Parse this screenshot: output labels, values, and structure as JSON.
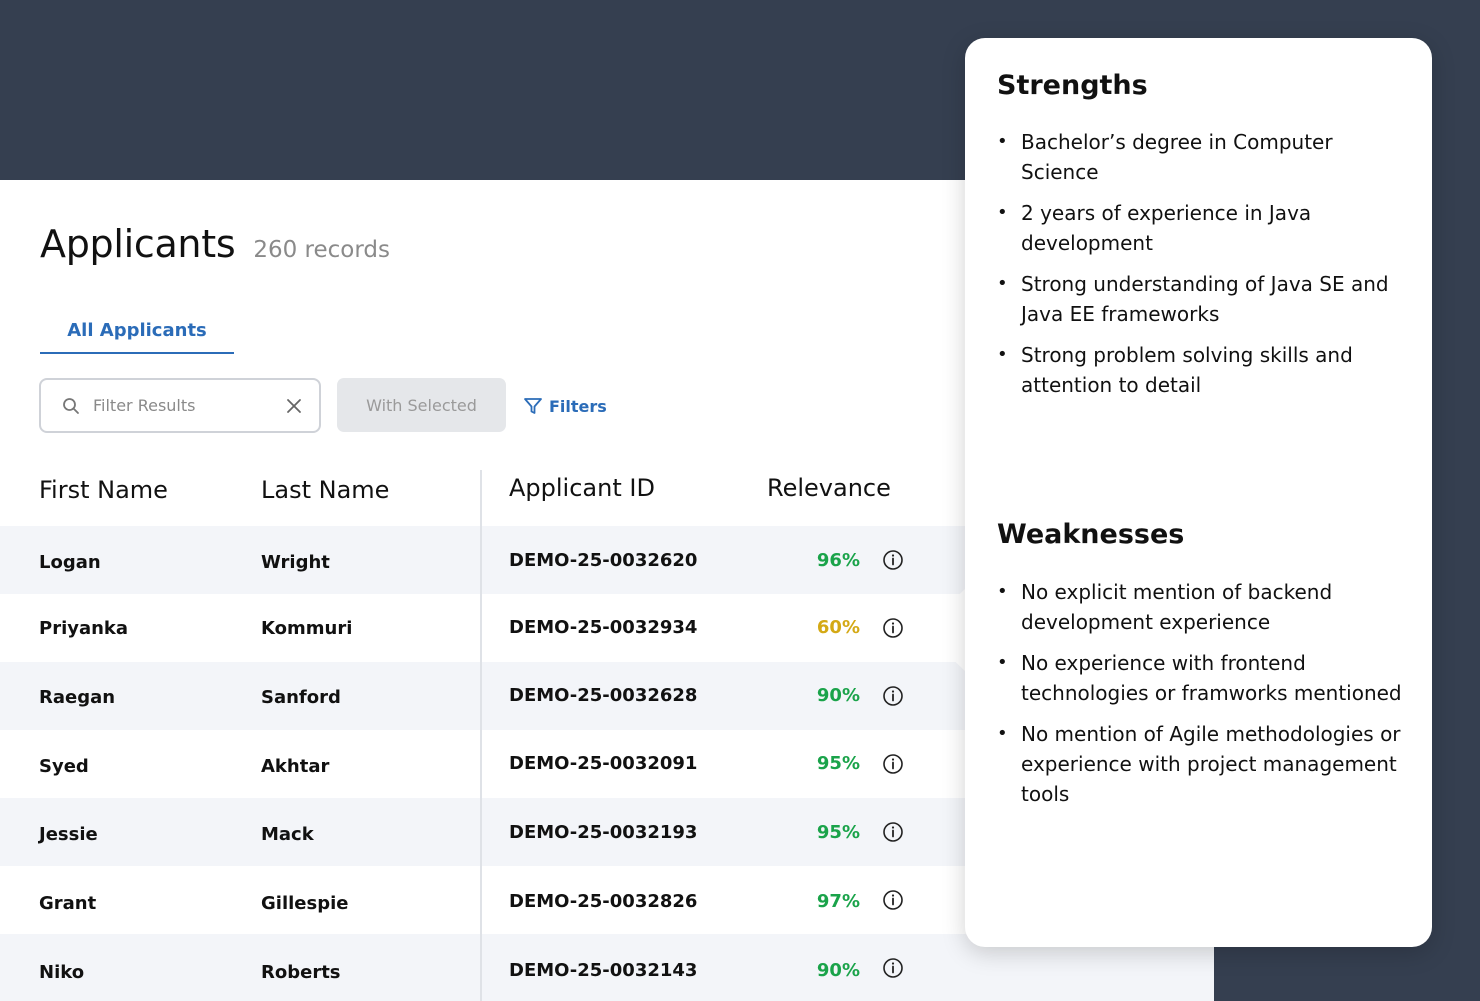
{
  "page": {
    "title": "Applicants",
    "record_count": "260 records"
  },
  "tabs": [
    {
      "label": "All Applicants",
      "active": true
    }
  ],
  "toolbar": {
    "search_placeholder": "Filter Results",
    "with_selected_label": "With Selected",
    "filters_label": "Filters"
  },
  "table": {
    "columns": [
      "First Name",
      "Last Name",
      "Applicant ID",
      "Relevance"
    ],
    "rows": [
      {
        "first": "Logan",
        "last": "Wright",
        "id": "DEMO-25-0032620",
        "relevance": "96%",
        "color": "#1aa34a"
      },
      {
        "first": "Priyanka",
        "last": "Kommuri",
        "id": "DEMO-25-0032934",
        "relevance": "60%",
        "color": "#d4a915"
      },
      {
        "first": "Raegan",
        "last": "Sanford",
        "id": "DEMO-25-0032628",
        "relevance": "90%",
        "color": "#1aa34a"
      },
      {
        "first": "Syed",
        "last": "Akhtar",
        "id": "DEMO-25-0032091",
        "relevance": "95%",
        "color": "#1aa34a"
      },
      {
        "first": "Jessie",
        "last": "Mack",
        "id": "DEMO-25-0032193",
        "relevance": "95%",
        "color": "#1aa34a"
      },
      {
        "first": "Grant",
        "last": "Gillespie",
        "id": "DEMO-25-0032826",
        "relevance": "97%",
        "color": "#1aa34a"
      },
      {
        "first": "Niko",
        "last": "Roberts",
        "id": "DEMO-25-0032143",
        "relevance": "90%",
        "color": "#1aa34a"
      }
    ]
  },
  "popover": {
    "strengths_title": "Strengths",
    "strengths": [
      "Bachelor’s degree in Computer Science",
      "2 years of experience in Java development",
      "Strong understanding of Java SE and Java EE frameworks",
      "Strong problem solving skills and attention to detail"
    ],
    "weaknesses_title": "Weaknesses",
    "weaknesses": [
      "No explicit mention of backend development experience",
      "No experience with frontend technologies or framworks mentioned",
      "No mention of Agile methodologies or experience with project management tools"
    ]
  },
  "icons": {
    "search": "search-icon",
    "clear": "close-icon",
    "filter": "filter-funnel-icon",
    "info": "info-icon"
  }
}
